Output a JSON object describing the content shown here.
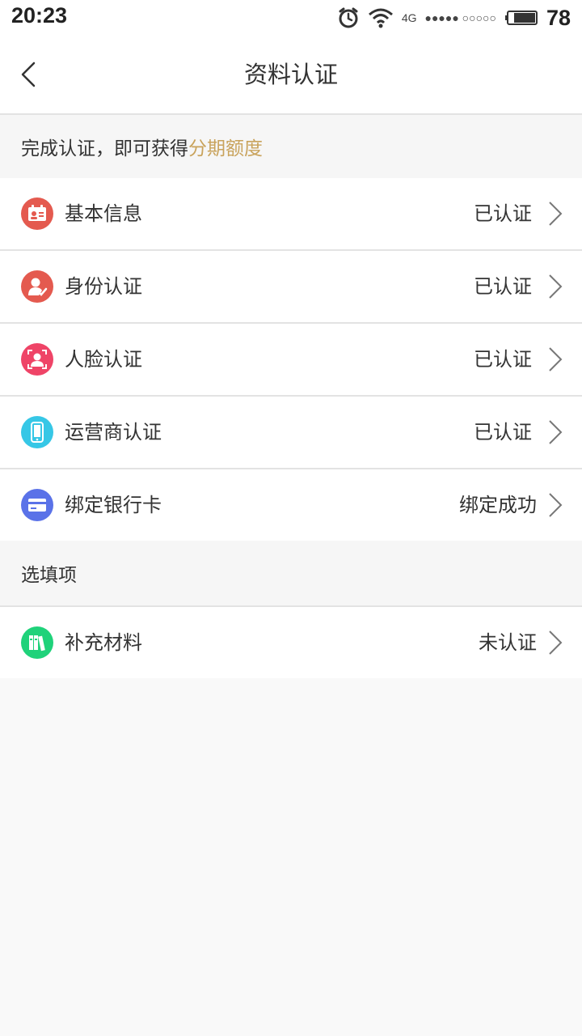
{
  "status_bar": {
    "time": "20:23",
    "network": "4G",
    "signal_dots": "●●●●● ○○○○○",
    "battery": "78"
  },
  "header": {
    "title": "资料认证"
  },
  "notice": {
    "prefix": "完成认证，即可获得",
    "highlight": "分期额度",
    "highlight_color": "#c9a35c"
  },
  "required_items": [
    {
      "label": "基本信息",
      "status": "已认证",
      "icon": "id-card-icon",
      "color": "#e45a4f"
    },
    {
      "label": "身份认证",
      "status": "已认证",
      "icon": "user-check-icon",
      "color": "#e45a4f"
    },
    {
      "label": "人脸认证",
      "status": "已认证",
      "icon": "face-scan-icon",
      "color": "#ef4467"
    },
    {
      "label": "运营商认证",
      "status": "已认证",
      "icon": "phone-icon",
      "color": "#36c7e6"
    },
    {
      "label": "绑定银行卡",
      "status": "绑定成功",
      "icon": "bank-card-icon",
      "color": "#5a72e8"
    }
  ],
  "optional_section": {
    "title": "选填项",
    "items": [
      {
        "label": "补充材料",
        "status": "未认证",
        "icon": "books-icon",
        "color": "#1fd27a"
      }
    ]
  }
}
